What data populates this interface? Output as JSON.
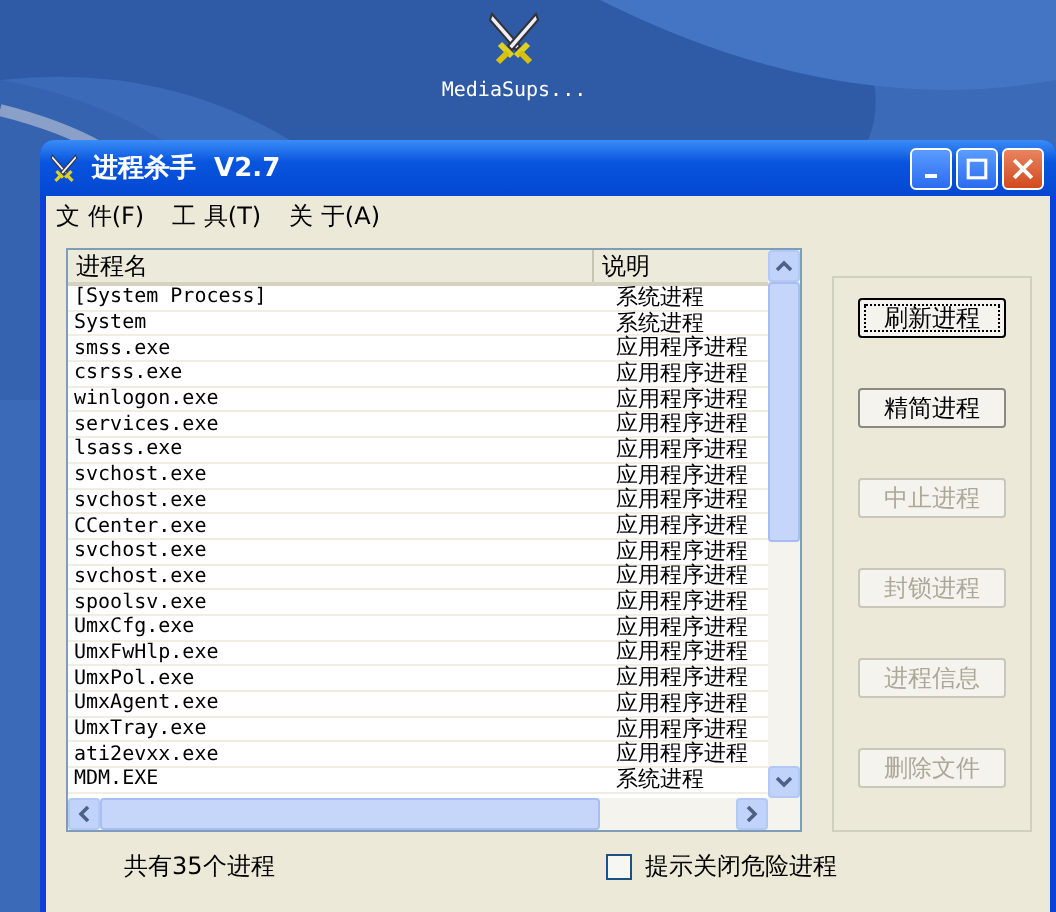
{
  "desktop_icon": {
    "label": "MediaSups..."
  },
  "window": {
    "title": "进程杀手  V2.7"
  },
  "menu": [
    "文 件(F)",
    "工 具(T)",
    "关 于(A)"
  ],
  "table": {
    "columns": [
      "进程名",
      "说明"
    ],
    "rows": [
      {
        "name": "[System Process]",
        "description": "系统进程"
      },
      {
        "name": "System",
        "description": "系统进程"
      },
      {
        "name": "smss.exe",
        "description": "应用程序进程"
      },
      {
        "name": "csrss.exe",
        "description": "应用程序进程"
      },
      {
        "name": "winlogon.exe",
        "description": "应用程序进程"
      },
      {
        "name": "services.exe",
        "description": "应用程序进程"
      },
      {
        "name": "lsass.exe",
        "description": "应用程序进程"
      },
      {
        "name": "svchost.exe",
        "description": "应用程序进程"
      },
      {
        "name": "svchost.exe",
        "description": "应用程序进程"
      },
      {
        "name": "CCenter.exe",
        "description": "应用程序进程"
      },
      {
        "name": "svchost.exe",
        "description": "应用程序进程"
      },
      {
        "name": "svchost.exe",
        "description": "应用程序进程"
      },
      {
        "name": "spoolsv.exe",
        "description": "应用程序进程"
      },
      {
        "name": "UmxCfg.exe",
        "description": "应用程序进程"
      },
      {
        "name": "UmxFwHlp.exe",
        "description": "应用程序进程"
      },
      {
        "name": "UmxPol.exe",
        "description": "应用程序进程"
      },
      {
        "name": "UmxAgent.exe",
        "description": "应用程序进程"
      },
      {
        "name": "UmxTray.exe",
        "description": "应用程序进程"
      },
      {
        "name": "ati2evxx.exe",
        "description": "应用程序进程"
      },
      {
        "name": "MDM.EXE",
        "description": "系统进程"
      }
    ]
  },
  "buttons": [
    {
      "label": "刷新进程",
      "disabled": false,
      "focused": true
    },
    {
      "label": "精简进程",
      "disabled": false,
      "focused": false
    },
    {
      "label": "中止进程",
      "disabled": true,
      "focused": false
    },
    {
      "label": "封锁进程",
      "disabled": true,
      "focused": false
    },
    {
      "label": "进程信息",
      "disabled": true,
      "focused": false
    },
    {
      "label": "删除文件",
      "disabled": true,
      "focused": false
    }
  ],
  "status": "共有35个进程",
  "option": {
    "label": "提示关闭危险进程",
    "checked": false
  }
}
